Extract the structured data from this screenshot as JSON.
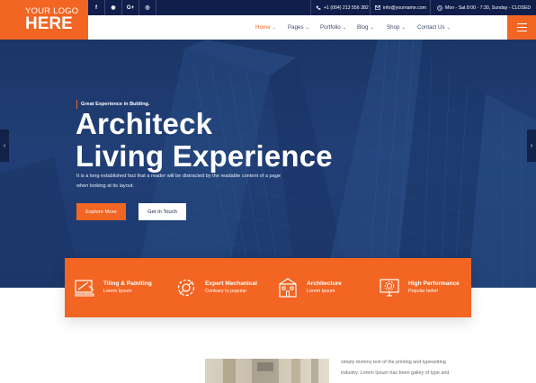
{
  "logo": {
    "line1": "YOUR LOGO",
    "line2": "HERE"
  },
  "topbar": {
    "social": [
      {
        "icon": "facebook-icon",
        "glyph": "f"
      },
      {
        "icon": "github-icon",
        "glyph": "◉"
      },
      {
        "icon": "google-plus-icon",
        "glyph": "G+"
      },
      {
        "icon": "instagram-icon",
        "glyph": "◎"
      }
    ],
    "phone": "+1 (004) 213 556 382",
    "email": "info@yourname.com",
    "hours": "Mon - Sat 8:00 - 7:30, Sunday - CLOSED"
  },
  "nav": {
    "items": [
      {
        "label": "Home",
        "active": true
      },
      {
        "label": "Pages",
        "active": false
      },
      {
        "label": "Portfolio",
        "active": false
      },
      {
        "label": "Blog",
        "active": false
      },
      {
        "label": "Shop",
        "active": false
      },
      {
        "label": "Contact Us",
        "active": false
      }
    ],
    "menu_icon": "hamburger-icon"
  },
  "hero": {
    "kicker": "Great Experience in Bulding.",
    "title_line1": "Architeck",
    "title_line2": "Living Experience",
    "description": "It is a long established fact that a reader will be distracted by the readable content of a page when looking at its layout.",
    "primary_button": "Explore More",
    "secondary_button": "Get In Touch",
    "prev_icon": "chevron-left-icon",
    "next_icon": "chevron-right-icon"
  },
  "services": [
    {
      "title": "Tiling & Painiting",
      "subtitle": "Lorem Ipsum",
      "icon": "tiling-tools-icon"
    },
    {
      "title": "Expert Mechanical",
      "subtitle": "Contrary to popular",
      "icon": "gear-icon"
    },
    {
      "title": "Architecture",
      "subtitle": "Lorem Ipsum",
      "icon": "building-icon"
    },
    {
      "title": "High Performance",
      "subtitle": "Popular belief",
      "icon": "monitor-gear-icon"
    }
  ],
  "about": {
    "line1": "simply dummy text of the printing and typesetting",
    "line2": "industry. Lorem Ipsum has been galley of type and"
  },
  "colors": {
    "accent": "#f26522",
    "navy": "#0f1e4b",
    "hero": "#1d3a6e"
  }
}
